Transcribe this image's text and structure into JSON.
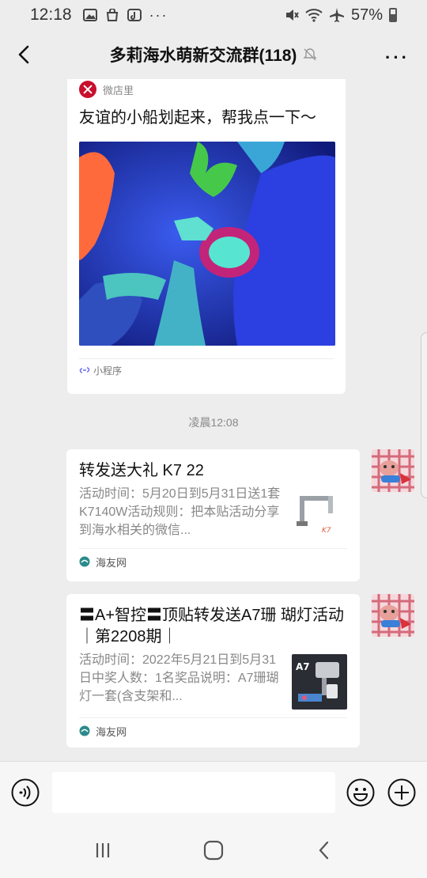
{
  "status": {
    "time": "12:18",
    "battery": "57%",
    "icons": [
      "image-icon",
      "shopping-bag-icon",
      "tiktok-icon",
      "more-dots-icon",
      "mute-icon",
      "wifi-icon",
      "airplane-icon",
      "battery-icon"
    ]
  },
  "header": {
    "title": "多莉海水萌新交流群(118)",
    "more": "···"
  },
  "messages": {
    "mini_program": {
      "source": "微店里",
      "text": "友谊的小船划起来，帮我点一下～",
      "footer": "小程序"
    },
    "timestamp": "凌晨12:08",
    "link1": {
      "title": "转发送大礼 K7 22",
      "desc": "活动时间：5月20日到5月31日送1套K7140W活动规则：把本贴活动分享到海水相关的微信...",
      "source": "海友网"
    },
    "link2": {
      "title": "〓A+智控〓顶贴转发送A7珊 瑚灯活动｜第2208期｜",
      "desc": "活动时间：2022年5月21日到5月31日中奖人数：1名奖品说明：A7珊瑚灯一套(含支架和...",
      "source": "海友网",
      "thumb_label": "A7"
    }
  },
  "input": {
    "value": ""
  },
  "colors": {
    "background": "#ededed",
    "card": "#ffffff",
    "reef_blue": "#2b3fd0"
  }
}
